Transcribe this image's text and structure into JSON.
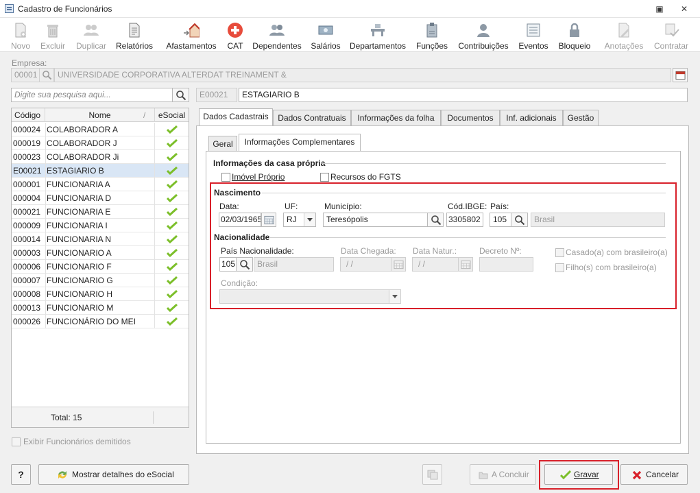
{
  "window": {
    "title": "Cadastro de Funcionários",
    "restore_glyph": "▣",
    "close_glyph": "✕"
  },
  "toolbar": {
    "novo": "Novo",
    "excluir": "Excluir",
    "duplicar": "Duplicar",
    "relatorios": "Relatórios",
    "afastamentos": "Afastamentos",
    "cat": "CAT",
    "dependentes": "Dependentes",
    "salarios": "Salários",
    "departamentos": "Departamentos",
    "funcoes": "Funções",
    "contribuicoes": "Contribuições",
    "eventos": "Eventos",
    "bloqueio": "Bloqueio",
    "anotacoes": "Anotações",
    "contratar": "Contratar"
  },
  "empresa": {
    "label": "Empresa:",
    "code": "00001",
    "name": "UNIVERSIDADE CORPORATIVA ALTERDAT TREINAMENT &"
  },
  "search": {
    "placeholder": "Digite sua pesquisa aqui..."
  },
  "employee": {
    "code": "E00021",
    "name": "ESTAGIARIO B"
  },
  "list": {
    "col_code": "Código",
    "col_name": "Nome",
    "col_sort": "/",
    "col_esocial": "eSocial",
    "rows": [
      {
        "code": "000024",
        "name": "COLABORADOR A"
      },
      {
        "code": "000019",
        "name": "COLABORADOR J"
      },
      {
        "code": "000023",
        "name": "COLABORADOR Ji"
      },
      {
        "code": "E00021",
        "name": "ESTAGIARIO B"
      },
      {
        "code": "000001",
        "name": "FUNCIONARIA A"
      },
      {
        "code": "000004",
        "name": "FUNCIONARIA D"
      },
      {
        "code": "000021",
        "name": "FUNCIONARIA E"
      },
      {
        "code": "000009",
        "name": "FUNCIONARIA I"
      },
      {
        "code": "000014",
        "name": "FUNCIONARIA N"
      },
      {
        "code": "000003",
        "name": "FUNCIONARIO A"
      },
      {
        "code": "000006",
        "name": "FUNCIONARIO F"
      },
      {
        "code": "000007",
        "name": "FUNCIONARIO G"
      },
      {
        "code": "000008",
        "name": "FUNCIONARIO H"
      },
      {
        "code": "000013",
        "name": "FUNCIONARIO M"
      },
      {
        "code": "000026",
        "name": "FUNCIONÁRIO DO MEI"
      }
    ],
    "total": "Total: 15"
  },
  "exibir_demitidos": "Exibir Funcionários demitidos",
  "help_glyph": "?",
  "tabs": {
    "dados_cadastrais": "Dados Cadastrais",
    "dados_contratuais": "Dados Contratuais",
    "informacoes_folha": "Informações da folha",
    "documentos": "Documentos",
    "inf_adicionais": "Inf. adicionais",
    "gestao": "Gestão"
  },
  "subtabs": {
    "geral": "Geral",
    "complementares": "Informações Complementares"
  },
  "casa_propria": {
    "title": "Informações da casa própria",
    "imovel": "Imóvel Próprio",
    "fgts": "Recursos do FGTS"
  },
  "nascimento": {
    "title": "Nascimento",
    "data_label": "Data:",
    "data_value": "02/03/1965",
    "uf_label": "UF:",
    "uf_value": "RJ",
    "municipio_label": "Município:",
    "municipio_value": "Teresópolis",
    "ibge_label": "Cód.IBGE:",
    "ibge_value": "3305802",
    "pais_label": "País:",
    "pais_code": "105",
    "pais_name": "Brasil"
  },
  "nacionalidade": {
    "title": "Nacionalidade",
    "pais_label": "País Nacionalidade:",
    "pais_code": "105",
    "pais_name": "Brasil",
    "chegada_label": "Data Chegada:",
    "chegada_value": "/ /",
    "natur_label": "Data Natur.:",
    "natur_value": "/ /",
    "decreto_label": "Decreto Nº:",
    "casado": "Casado(a) com brasileiro(a)",
    "filho": "Filho(s) com brasileiro(a)",
    "condicao_label": "Condição:"
  },
  "buttons": {
    "mostrar_esocial": "Mostrar detalhes do eSocial",
    "concluir": "A Concluir",
    "gravar": "Gravar",
    "cancelar": "Cancelar"
  },
  "colors": {
    "highlight": "#d8202a",
    "selection": "#d9e6f5",
    "check": "#7cbf2a"
  }
}
